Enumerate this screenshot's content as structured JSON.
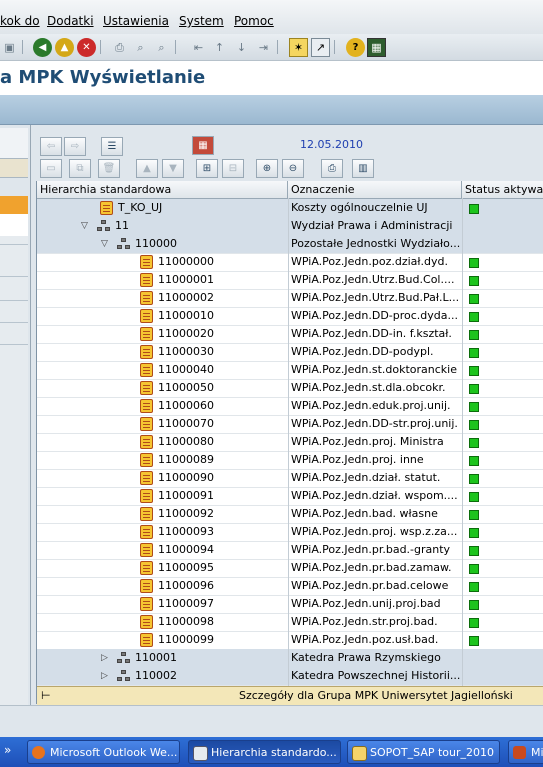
{
  "menu": [
    "kok do",
    "Dodatki",
    "Ustawienia",
    "System",
    "Pomoc"
  ],
  "title": "a MPK Wyświetlanie",
  "toolbar_date": "12.05.2010",
  "columns": [
    "Hierarchia standardowa",
    "Oznaczenie",
    "Status aktywacji"
  ],
  "rows": [
    {
      "node": "T_KO_UJ",
      "desc": "Koszty ogólnouczelnie UJ",
      "status": true,
      "type": "leaf",
      "indent": 0,
      "toggle": ""
    },
    {
      "node": "11",
      "desc": "Wydział Prawa i Administracji",
      "status": false,
      "type": "group",
      "indent": 0,
      "toggle": "open"
    },
    {
      "node": "110000",
      "desc": "Pozostałe Jednostki Wydziało...",
      "status": false,
      "type": "group",
      "indent": 1,
      "toggle": "open"
    },
    {
      "node": "11000000",
      "desc": "WPiA.Poz.Jedn.poz.dział.dyd.",
      "status": true,
      "type": "leaf",
      "indent": 2,
      "toggle": ""
    },
    {
      "node": "11000001",
      "desc": "WPiA.Poz.Jedn.Utrz.Bud.Col....",
      "status": true,
      "type": "leaf",
      "indent": 2,
      "toggle": ""
    },
    {
      "node": "11000002",
      "desc": "WPiA.Poz.Jedn.Utrz.Bud.Pał.L...",
      "status": true,
      "type": "leaf",
      "indent": 2,
      "toggle": ""
    },
    {
      "node": "11000010",
      "desc": "WPiA.Poz.Jedn.DD-proc.dyda...",
      "status": true,
      "type": "leaf",
      "indent": 2,
      "toggle": ""
    },
    {
      "node": "11000020",
      "desc": "WPiA.Poz.Jedn.DD-in. f.kształ.",
      "status": true,
      "type": "leaf",
      "indent": 2,
      "toggle": ""
    },
    {
      "node": "11000030",
      "desc": "WPiA.Poz.Jedn.DD-podypl.",
      "status": true,
      "type": "leaf",
      "indent": 2,
      "toggle": ""
    },
    {
      "node": "11000040",
      "desc": "WPiA.Poz.Jedn.st.doktoranckie",
      "status": true,
      "type": "leaf",
      "indent": 2,
      "toggle": ""
    },
    {
      "node": "11000050",
      "desc": "WPiA.Poz.Jedn.st.dla.obcokr.",
      "status": true,
      "type": "leaf",
      "indent": 2,
      "toggle": ""
    },
    {
      "node": "11000060",
      "desc": "WPiA.Poz.Jedn.eduk.proj.unij.",
      "status": true,
      "type": "leaf",
      "indent": 2,
      "toggle": ""
    },
    {
      "node": "11000070",
      "desc": "WPiA.Poz.Jedn.DD-str.proj.unij.",
      "status": true,
      "type": "leaf",
      "indent": 2,
      "toggle": ""
    },
    {
      "node": "11000080",
      "desc": "WPiA.Poz.Jedn.proj. Ministra",
      "status": true,
      "type": "leaf",
      "indent": 2,
      "toggle": ""
    },
    {
      "node": "11000089",
      "desc": "WPiA.Poz.Jedn.proj. inne",
      "status": true,
      "type": "leaf",
      "indent": 2,
      "toggle": ""
    },
    {
      "node": "11000090",
      "desc": "WPiA.Poz.Jedn.dział. statut.",
      "status": true,
      "type": "leaf",
      "indent": 2,
      "toggle": ""
    },
    {
      "node": "11000091",
      "desc": "WPiA.Poz.Jedn.dział. wspom....",
      "status": true,
      "type": "leaf",
      "indent": 2,
      "toggle": ""
    },
    {
      "node": "11000092",
      "desc": "WPiA.Poz.Jedn.bad. własne",
      "status": true,
      "type": "leaf",
      "indent": 2,
      "toggle": ""
    },
    {
      "node": "11000093",
      "desc": "WPiA.Poz.Jedn.proj. wsp.z.za...",
      "status": true,
      "type": "leaf",
      "indent": 2,
      "toggle": ""
    },
    {
      "node": "11000094",
      "desc": "WPiA.Poz.Jedn.pr.bad.-granty",
      "status": true,
      "type": "leaf",
      "indent": 2,
      "toggle": ""
    },
    {
      "node": "11000095",
      "desc": "WPiA.Poz.Jedn.pr.bad.zamaw.",
      "status": true,
      "type": "leaf",
      "indent": 2,
      "toggle": ""
    },
    {
      "node": "11000096",
      "desc": "WPiA.Poz.Jedn.pr.bad.celowe",
      "status": true,
      "type": "leaf",
      "indent": 2,
      "toggle": ""
    },
    {
      "node": "11000097",
      "desc": "WPiA.Poz.Jedn.unij.proj.bad",
      "status": true,
      "type": "leaf",
      "indent": 2,
      "toggle": ""
    },
    {
      "node": "11000098",
      "desc": "WPiA.Poz.Jedn.str.proj.bad.",
      "status": true,
      "type": "leaf",
      "indent": 2,
      "toggle": ""
    },
    {
      "node": "11000099",
      "desc": "WPiA.Poz.Jedn.poz.usł.bad.",
      "status": true,
      "type": "leaf",
      "indent": 2,
      "toggle": ""
    },
    {
      "node": "110001",
      "desc": "Katedra Prawa Rzymskiego",
      "status": false,
      "type": "group",
      "indent": 1,
      "toggle": "closed"
    },
    {
      "node": "110002",
      "desc": "Katedra Powszechnej Historii...",
      "status": false,
      "type": "group",
      "indent": 1,
      "toggle": "closed"
    }
  ],
  "footer": "Szczegóły dla Grupa MPK Uniwersytet Jagielloński",
  "taskbar": [
    "Microsoft Outlook We...",
    "Hierarchia standardo...",
    "SOPOT_SAP tour_2010",
    "Mi"
  ],
  "colors": {
    "status_active": "#1dc41d",
    "title": "#1f4d75",
    "selected": "#f0a22e"
  }
}
